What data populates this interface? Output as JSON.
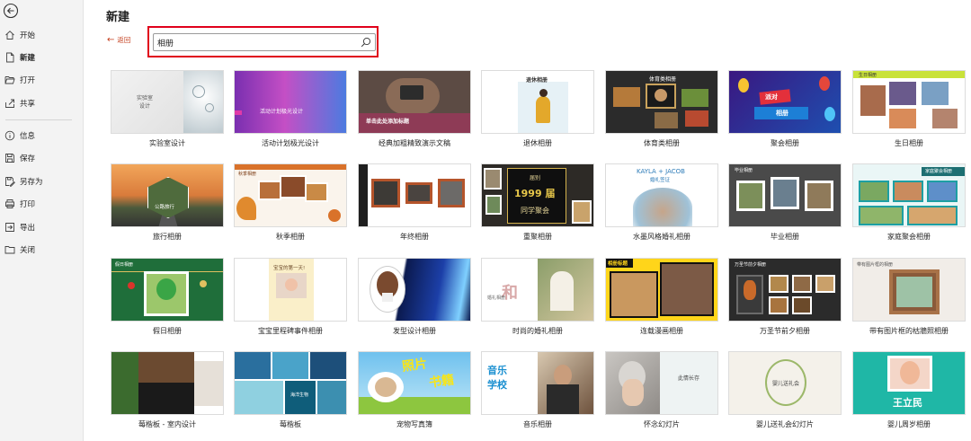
{
  "sidebar": {
    "items": [
      {
        "label": "开始",
        "icon": "home-icon"
      },
      {
        "label": "新建",
        "icon": "new-file-icon"
      },
      {
        "label": "打开",
        "icon": "folder-open-icon"
      },
      {
        "label": "共享",
        "icon": "share-icon"
      },
      {
        "label": "信息",
        "icon": "info-icon"
      },
      {
        "label": "保存",
        "icon": "save-icon"
      },
      {
        "label": "另存为",
        "icon": "save-as-icon"
      },
      {
        "label": "打印",
        "icon": "print-icon"
      },
      {
        "label": "导出",
        "icon": "export-icon"
      },
      {
        "label": "关闭",
        "icon": "close-folder-icon"
      }
    ]
  },
  "header": {
    "title": "新建",
    "back_label": "返回"
  },
  "search": {
    "value": "相册"
  },
  "templates": [
    {
      "label": "实验室设计",
      "thumb_text": [
        "实验室",
        "设计"
      ]
    },
    {
      "label": "活动计划极光设计",
      "thumb_text": [
        "活动计划极光设计"
      ]
    },
    {
      "label": "经典加粗精致演示文稿",
      "thumb_text": [
        "单击此处添加标题"
      ]
    },
    {
      "label": "退休相册",
      "thumb_text": [
        "退休相册"
      ]
    },
    {
      "label": "体育类相册",
      "thumb_text": [
        "体育类相册"
      ]
    },
    {
      "label": "聚会相册",
      "thumb_text": [
        "派对",
        "相册"
      ]
    },
    {
      "label": "生日相册",
      "thumb_text": [
        "生日相册"
      ]
    },
    {
      "label": "旅行相册",
      "thumb_text": [
        "公路旅行"
      ]
    },
    {
      "label": "秋季相册",
      "thumb_text": [
        "秋季相册"
      ]
    },
    {
      "label": "年终相册",
      "thumb_text": []
    },
    {
      "label": "重聚相册",
      "thumb_text": [
        "届别",
        "1999 届",
        "同学聚会"
      ]
    },
    {
      "label": "水墨风格婚礼相册",
      "thumb_text": [
        "KAYLA + JACOB",
        "婚礼签证"
      ]
    },
    {
      "label": "毕业相册",
      "thumb_text": [
        "毕业相册"
      ]
    },
    {
      "label": "家庭聚会相册",
      "thumb_text": [
        "家庭聚会相册"
      ]
    },
    {
      "label": "假日相册",
      "thumb_text": [
        "假日相册"
      ]
    },
    {
      "label": "宝宝里程碑事件相册",
      "thumb_text": [
        "宝宝的第一天!"
      ]
    },
    {
      "label": "发型设计相册",
      "thumb_text": []
    },
    {
      "label": "时尚的婚礼相册",
      "thumb_text": [
        "和",
        "婚礼相册"
      ]
    },
    {
      "label": "连载漫画相册",
      "thumb_text": [
        "相册标题"
      ]
    },
    {
      "label": "万圣节前夕相册",
      "thumb_text": [
        "万圣节前夕相册"
      ]
    },
    {
      "label": "带有图片框的枯牆照相册",
      "thumb_text": [
        "带有图片框的相册"
      ]
    },
    {
      "label": "莓楷板 - 室内设计",
      "thumb_text": []
    },
    {
      "label": "莓楷板",
      "thumb_text": [
        "海洋生物"
      ]
    },
    {
      "label": "宠物写真簿",
      "thumb_text": [
        "照片",
        "书籍"
      ]
    },
    {
      "label": "音乐相册",
      "thumb_text": [
        "音乐",
        "学校"
      ]
    },
    {
      "label": "怀念幻灯片",
      "thumb_text": [
        "此情长存"
      ]
    },
    {
      "label": "婴儿送礼会幻灯片",
      "thumb_text": [
        "婴儿送礼会"
      ]
    },
    {
      "label": "婴儿周岁相册",
      "thumb_text": [
        "王立民"
      ]
    }
  ],
  "colors": {
    "accent": "#c43e1c",
    "highlight": "#e0001b",
    "sidebar_bg": "#f3f3f3"
  }
}
